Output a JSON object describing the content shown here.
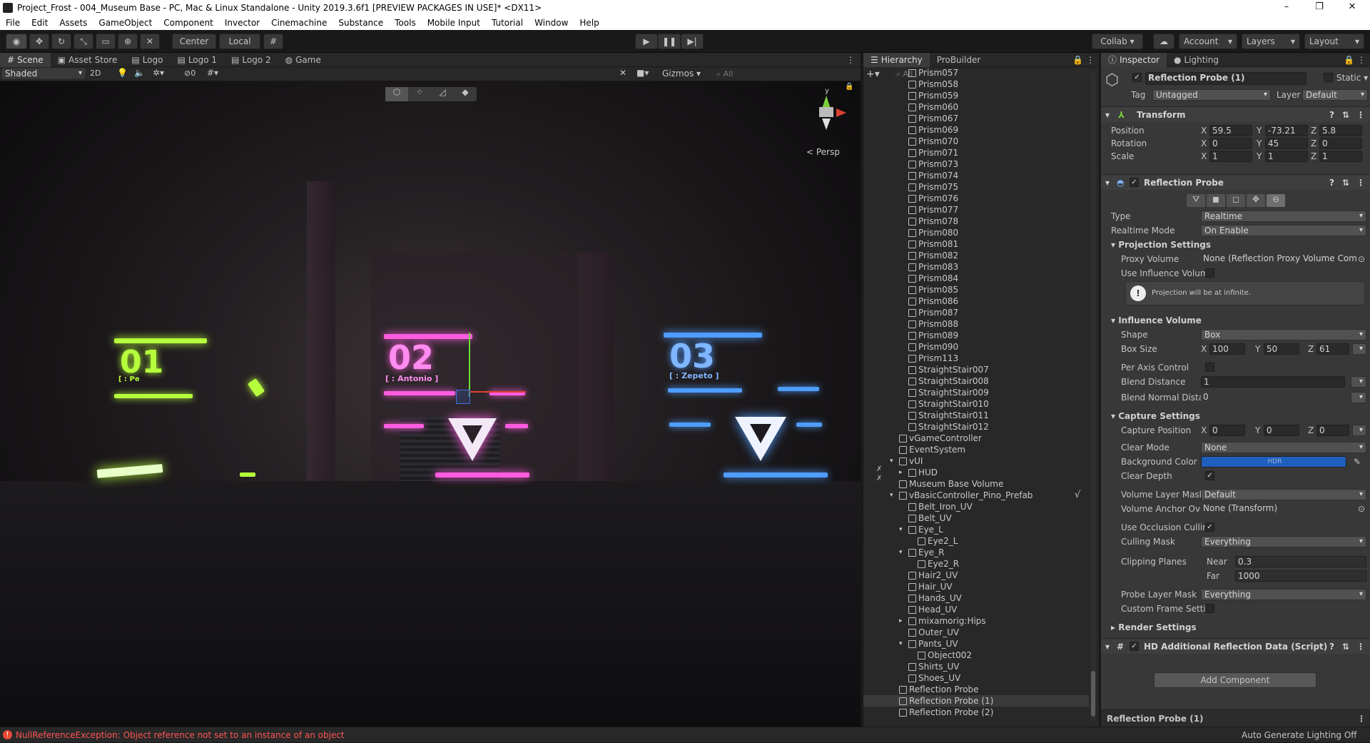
{
  "window": {
    "title": "Project_Frost - 004_Museum Base - PC, Mac & Linux Standalone - Unity 2019.3.6f1 [PREVIEW PACKAGES IN USE]* <DX11>",
    "minimize": "–",
    "maximize": "❐",
    "close": "✕"
  },
  "menu": [
    "File",
    "Edit",
    "Assets",
    "GameObject",
    "Component",
    "Invector",
    "Cinemachine",
    "Substance",
    "Tools",
    "Mobile Input",
    "Tutorial",
    "Window",
    "Help"
  ],
  "toolbar": {
    "pivot": "Center",
    "space": "Local",
    "collab": "Collab ▾",
    "account": "Account",
    "layers": "Layers",
    "layout": "Layout"
  },
  "scene_tabs": [
    "Scene",
    "Asset Store",
    "Logo",
    "Logo 1",
    "Logo 2",
    "Game"
  ],
  "scene_bar": {
    "shading": "Shaded",
    "mode2d": "2D",
    "fx_count": "0",
    "gizmos": "Gizmos",
    "search_placeholder": "All"
  },
  "gizmo": {
    "label": "< Persp",
    "y": "y"
  },
  "exhibits": [
    {
      "num": "01",
      "name": "[ : Pe",
      "color": "#b6ff3c"
    },
    {
      "num": "02",
      "name": "[ : Antonio ]",
      "color": "#ff5ce0"
    },
    {
      "num": "03",
      "name": "[ : Zepeto ]",
      "color": "#4f9dff"
    }
  ],
  "hierarchy": {
    "tabs": [
      "Hierarchy",
      "ProBuilder"
    ],
    "search_placeholder": "All",
    "items": [
      {
        "label": "Prism057",
        "indent": 2
      },
      {
        "label": "Prism058",
        "indent": 2
      },
      {
        "label": "Prism059",
        "indent": 2
      },
      {
        "label": "Prism060",
        "indent": 2
      },
      {
        "label": "Prism067",
        "indent": 2
      },
      {
        "label": "Prism069",
        "indent": 2
      },
      {
        "label": "Prism070",
        "indent": 2
      },
      {
        "label": "Prism071",
        "indent": 2
      },
      {
        "label": "Prism073",
        "indent": 2
      },
      {
        "label": "Prism074",
        "indent": 2
      },
      {
        "label": "Prism075",
        "indent": 2
      },
      {
        "label": "Prism076",
        "indent": 2
      },
      {
        "label": "Prism077",
        "indent": 2
      },
      {
        "label": "Prism078",
        "indent": 2
      },
      {
        "label": "Prism080",
        "indent": 2
      },
      {
        "label": "Prism081",
        "indent": 2
      },
      {
        "label": "Prism082",
        "indent": 2
      },
      {
        "label": "Prism083",
        "indent": 2
      },
      {
        "label": "Prism084",
        "indent": 2
      },
      {
        "label": "Prism085",
        "indent": 2
      },
      {
        "label": "Prism086",
        "indent": 2
      },
      {
        "label": "Prism087",
        "indent": 2
      },
      {
        "label": "Prism088",
        "indent": 2
      },
      {
        "label": "Prism089",
        "indent": 2
      },
      {
        "label": "Prism090",
        "indent": 2
      },
      {
        "label": "Prism113",
        "indent": 2
      },
      {
        "label": "StraightStair007",
        "indent": 2
      },
      {
        "label": "StraightStair008",
        "indent": 2
      },
      {
        "label": "StraightStair009",
        "indent": 2
      },
      {
        "label": "StraightStair010",
        "indent": 2
      },
      {
        "label": "StraightStair011",
        "indent": 2
      },
      {
        "label": "StraightStair012",
        "indent": 2
      },
      {
        "label": "vGameController",
        "indent": 1
      },
      {
        "label": "EventSystem",
        "indent": 1
      },
      {
        "label": "vUI",
        "indent": 1,
        "fold": "▾"
      },
      {
        "label": "HUD",
        "indent": 2,
        "fold": "▸"
      },
      {
        "label": "Museum Base Volume",
        "indent": 1
      },
      {
        "label": "vBasicController_Pino_Prefab",
        "indent": 1,
        "fold": "▾",
        "check": "√"
      },
      {
        "label": "Belt_Iron_UV",
        "indent": 2
      },
      {
        "label": "Belt_UV",
        "indent": 2
      },
      {
        "label": "Eye_L",
        "indent": 2,
        "fold": "▾"
      },
      {
        "label": "Eye2_L",
        "indent": 3
      },
      {
        "label": "Eye_R",
        "indent": 2,
        "fold": "▾"
      },
      {
        "label": "Eye2_R",
        "indent": 3
      },
      {
        "label": "Hair2_UV",
        "indent": 2
      },
      {
        "label": "Hair_UV",
        "indent": 2
      },
      {
        "label": "Hands_UV",
        "indent": 2
      },
      {
        "label": "Head_UV",
        "indent": 2
      },
      {
        "label": "mixamorig:Hips",
        "indent": 2,
        "fold": "▸"
      },
      {
        "label": "Outer_UV",
        "indent": 2
      },
      {
        "label": "Pants_UV",
        "indent": 2,
        "fold": "▾"
      },
      {
        "label": "Object002",
        "indent": 3
      },
      {
        "label": "Shirts_UV",
        "indent": 2
      },
      {
        "label": "Shoes_UV",
        "indent": 2
      },
      {
        "label": "Reflection Probe",
        "indent": 1
      },
      {
        "label": "Reflection Probe (1)",
        "indent": 1,
        "selected": true
      },
      {
        "label": "Reflection Probe (2)",
        "indent": 1
      }
    ]
  },
  "inspector": {
    "tabs": [
      "Inspector",
      "Lighting"
    ],
    "object_name": "Reflection Probe (1)",
    "static_label": "Static",
    "tag_label": "Tag",
    "tag_value": "Untagged",
    "layer_label": "Layer",
    "layer_value": "Default",
    "transform": {
      "title": "Transform",
      "position": {
        "label": "Position",
        "x": "59.5",
        "y": "-73.21",
        "z": "5.8"
      },
      "rotation": {
        "label": "Rotation",
        "x": "0",
        "y": "45",
        "z": "0"
      },
      "scale": {
        "label": "Scale",
        "x": "1",
        "y": "1",
        "z": "1"
      }
    },
    "probe": {
      "title": "Reflection Probe",
      "type_label": "Type",
      "type_value": "Realtime",
      "rtmode_label": "Realtime Mode",
      "rtmode_value": "On Enable",
      "projection_title": "Projection Settings",
      "proxy_label": "Proxy Volume",
      "proxy_value": "None (Reflection Proxy Volume Com",
      "use_influence_label": "Use Influence Volum",
      "info": "Projection will be at infinite.",
      "influence_title": "Influence Volume",
      "shape_label": "Shape",
      "shape_value": "Box",
      "boxsize_label": "Box Size",
      "box_x": "100",
      "box_y": "50",
      "box_z": "61",
      "per_axis_label": "Per Axis Control",
      "blend_label": "Blend Distance",
      "blend_value": "1",
      "blend_normal_label": "Blend Normal Distan",
      "blend_normal_value": "0",
      "capture_title": "Capture Settings",
      "cap_pos_label": "Capture Position",
      "cap_x": "0",
      "cap_y": "0",
      "cap_z": "0",
      "clear_mode_label": "Clear Mode",
      "clear_mode_value": "None",
      "bg_color_label": "Background Color",
      "bg_color_text": "HDR",
      "bg_color": "#1f5fbd",
      "clear_depth_label": "Clear Depth",
      "vol_mask_label": "Volume Layer Mask",
      "vol_mask_value": "Default",
      "vol_anchor_label": "Volume Anchor Over",
      "vol_anchor_value": "None (Transform)",
      "occlusion_label": "Use Occlusion Cullir",
      "culling_label": "Culling Mask",
      "culling_value": "Everything",
      "clipping_label": "Clipping Planes",
      "near_label": "Near",
      "near_value": "0.3",
      "far_label": "Far",
      "far_value": "1000",
      "probe_mask_label": "Probe Layer Mask",
      "probe_mask_value": "Everything",
      "custom_frame_label": "Custom Frame Settir",
      "render_title": "Render Settings"
    },
    "hd_title": "HD Additional Reflection Data (Script)",
    "add_component": "Add Component",
    "footer": "Reflection Probe (1)"
  },
  "status": {
    "error": "NullReferenceException: Object reference not set to an instance of an object",
    "lighting": "Auto Generate Lighting Off",
    "error_color": "#ff5353"
  }
}
